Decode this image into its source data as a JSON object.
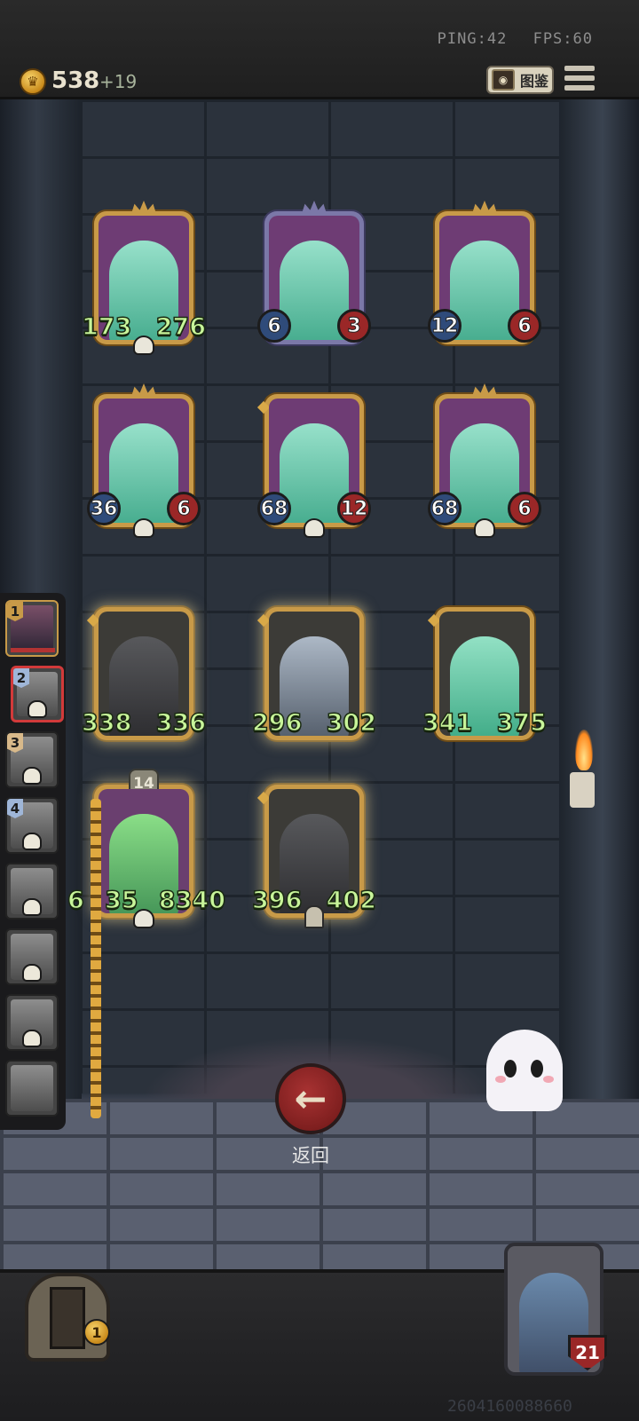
{
  "top": {
    "ping": "PING:42",
    "fps": "FPS:60",
    "gold": "538",
    "gold_income": "+19",
    "codex_label": "图鉴"
  },
  "enemy_board": [
    {
      "name": "ghost-king",
      "attack": "173",
      "health": "276",
      "style": "stat",
      "frame": "gold",
      "skull": true
    },
    {
      "name": "ghost-sorcerer",
      "attack": "6",
      "health": "3",
      "style": "bubble",
      "frame": "purple",
      "skull": false
    },
    {
      "name": "ghost-sorcerer",
      "attack": "12",
      "health": "6",
      "style": "bubble",
      "frame": "gold",
      "skull": false
    },
    {
      "name": "ghost-sorcerer",
      "attack": "36",
      "health": "6",
      "style": "bubble",
      "frame": "gold",
      "skull": true
    },
    {
      "name": "ghost-skull-lady",
      "attack": "68",
      "health": "12",
      "style": "stat",
      "frame": "gold",
      "skull": true
    },
    {
      "name": "ghost-writer",
      "attack": "68",
      "health": "6",
      "style": "bubble",
      "frame": "gold",
      "skull": true
    }
  ],
  "player_board": [
    {
      "name": "hooded-rogue",
      "attack": "338",
      "health": "336"
    },
    {
      "name": "elf-witch",
      "attack": "296",
      "health": "302"
    },
    {
      "name": "ghost-king",
      "attack": "341",
      "health": "375"
    },
    {
      "name": "green-ghoul",
      "attack": "6",
      "health": "35",
      "extra": "8340",
      "level": "14"
    },
    {
      "name": "reaper",
      "attack": "396",
      "health": "402"
    }
  ],
  "hand": [
    {
      "num": "1"
    },
    {
      "num": "2"
    },
    {
      "num": "3"
    },
    {
      "num": "4"
    },
    {
      "num": ""
    },
    {
      "num": ""
    },
    {
      "num": ""
    },
    {
      "num": ""
    }
  ],
  "back_button": {
    "icon": "←",
    "label": "返回"
  },
  "shop": {
    "coins": "1"
  },
  "hero": {
    "health": "21"
  },
  "seed": "2604160088660"
}
